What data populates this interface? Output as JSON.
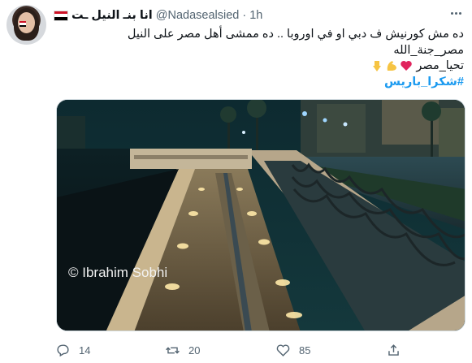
{
  "tweet": {
    "display_name": "انا بنـ النيل ـت",
    "handle": "@Nadasealsied",
    "separator": "·",
    "time": "1h",
    "text_line1": "ده مش كورنيش ف دبي او في اوروبا .. ده ممشى أهل مصر على النيل",
    "text_line2": "مصر_جنة_الله",
    "text_line3": "تحيا_مصر",
    "hashtag": "#شكرا_باريس",
    "image_watermark": "© Ibrahim Sobhi"
  },
  "icons": {
    "avatar": "avatar",
    "flag": "egypt-flag-icon",
    "more": "more-icon",
    "reply": "reply-icon",
    "retweet": "retweet-icon",
    "like": "heart-icon",
    "share": "share-icon"
  },
  "actions": {
    "reply_count": "14",
    "retweet_count": "20",
    "like_count": "85"
  },
  "colors": {
    "accent": "#1d9bf0",
    "secondary_text": "#536471",
    "flag_red": "#ce1126",
    "flag_white": "#ffffff",
    "flag_black": "#000000"
  }
}
